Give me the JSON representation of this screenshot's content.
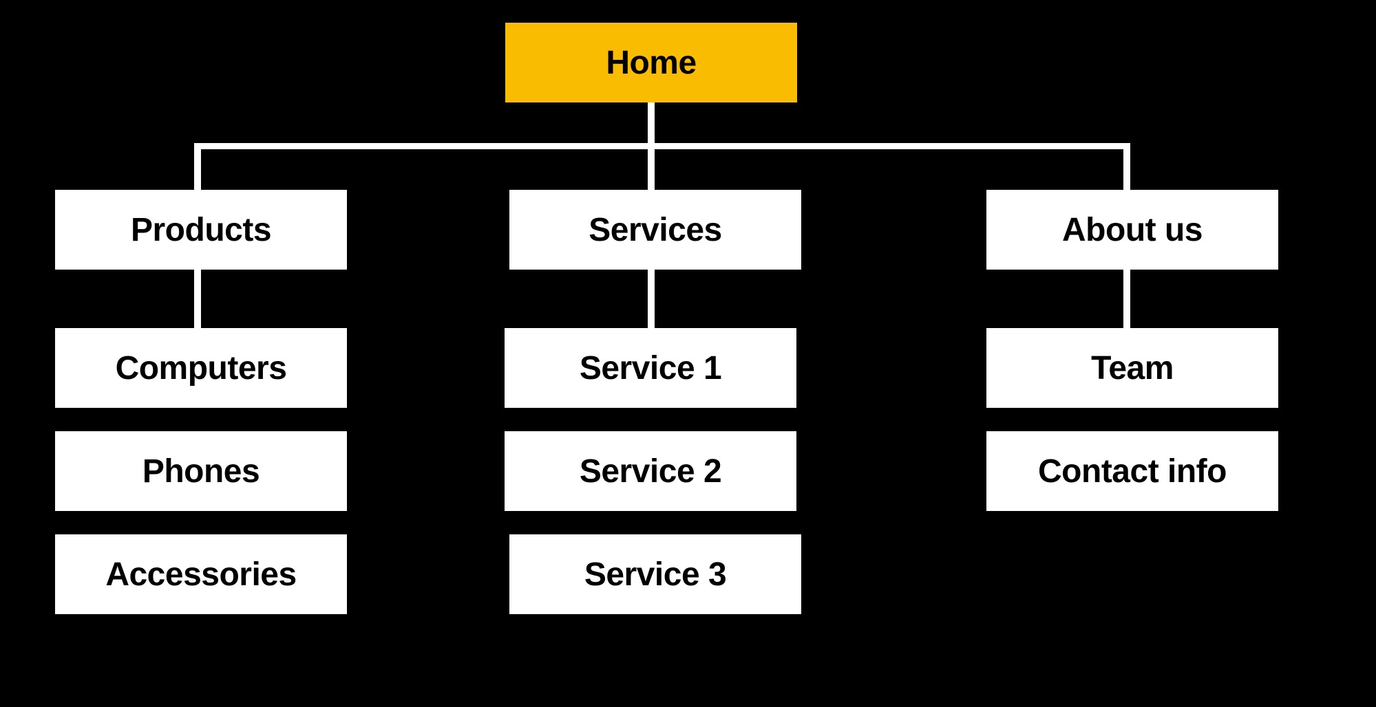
{
  "diagram": {
    "type": "sitemap-tree",
    "colors": {
      "background": "#000000",
      "root_fill": "#FABC00",
      "node_fill": "#FFFFFF",
      "connector": "#FFFFFF",
      "text": "#000000"
    },
    "root": {
      "label": "Home"
    },
    "sections": [
      {
        "label": "Products",
        "children": [
          {
            "label": "Computers"
          },
          {
            "label": "Phones"
          },
          {
            "label": "Accessories"
          }
        ]
      },
      {
        "label": "Services",
        "children": [
          {
            "label": "Service 1"
          },
          {
            "label": "Service 2"
          },
          {
            "label": "Service 3"
          }
        ]
      },
      {
        "label": "About us",
        "children": [
          {
            "label": "Team"
          },
          {
            "label": "Contact info"
          }
        ]
      }
    ],
    "edges": [
      [
        "Home",
        "Products"
      ],
      [
        "Home",
        "Services"
      ],
      [
        "Home",
        "About us"
      ],
      [
        "Products",
        "Computers"
      ],
      [
        "Services",
        "Service 1"
      ],
      [
        "About us",
        "Team"
      ]
    ]
  }
}
